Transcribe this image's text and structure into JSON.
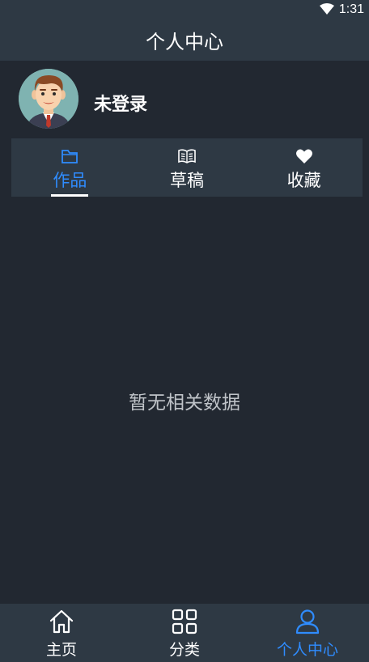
{
  "status_bar": {
    "time": "1:31",
    "wifi_icon": "wifi-icon"
  },
  "header": {
    "title": "个人中心"
  },
  "profile": {
    "avatar_icon": "avatar-cartoon-man",
    "username": "未登录"
  },
  "tabs": [
    {
      "label": "作品",
      "icon": "folder-icon",
      "active": true
    },
    {
      "label": "草稿",
      "icon": "open-book-icon",
      "active": false
    },
    {
      "label": "收藏",
      "icon": "heart-icon",
      "active": false
    }
  ],
  "empty_state": {
    "message": "暂无相关数据"
  },
  "bottom_nav": [
    {
      "label": "主页",
      "icon": "home-icon",
      "active": false
    },
    {
      "label": "分类",
      "icon": "grid-icon",
      "active": false
    },
    {
      "label": "个人中心",
      "icon": "user-icon",
      "active": true
    }
  ],
  "colors": {
    "background": "#222831",
    "bar": "#2e3944",
    "accent": "#2f8cff",
    "text": "#ffffff",
    "muted_text": "#bfc3c8"
  }
}
